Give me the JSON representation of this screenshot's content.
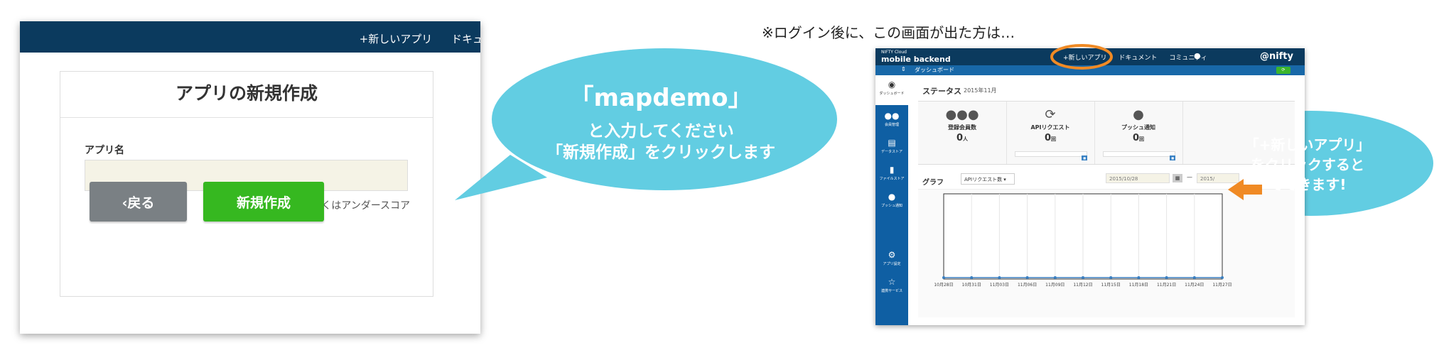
{
  "left_screen": {
    "nav_items": [
      "+新しいアプリ",
      "ドキュ"
    ],
    "card_title": "アプリの新規作成",
    "field_label": "アプリ名",
    "app_name_value": "",
    "hint": "半角英数字もしくはアンダースコア",
    "back_label": "‹戻る",
    "create_label": "新規作成"
  },
  "bubble1": {
    "line1": "「mapdemo」",
    "line2": "と入力してください",
    "line3": "「新規作成」をクリックします"
  },
  "note": "※ログイン後に、この画面が出た方は…",
  "right_screen": {
    "brand_small": "NIFTY Cloud",
    "brand": "mobile backend",
    "nav_items": [
      "+新しいアプリ",
      "ドキュメント",
      "コミュニティ"
    ],
    "logo": "@nifty",
    "breadcrumb": "ダッシュボード",
    "sidebar": [
      {
        "icon": "speedometer-icon",
        "label": "ダッシュボード"
      },
      {
        "icon": "users-icon",
        "label": "会員管理"
      },
      {
        "icon": "database-icon",
        "label": "データストア"
      },
      {
        "icon": "file-icon",
        "label": "ファイルストア"
      },
      {
        "icon": "chat-icon",
        "label": "プッシュ通知"
      },
      {
        "icon": "gear-icon",
        "label": "アプリ設定"
      },
      {
        "icon": "network-icon",
        "label": "連携サービス"
      }
    ],
    "status_title": "ステータス",
    "status_date": "2015年11月",
    "stats": [
      {
        "label": "登録会員数",
        "value": "0",
        "unit": "人"
      },
      {
        "label": "APIリクエスト",
        "value": "0",
        "unit": "回"
      },
      {
        "label": "プッシュ通知",
        "value": "0",
        "unit": "回"
      }
    ],
    "graph_title": "グラフ",
    "graph_select": "APIリクエスト数",
    "date_from": "2015/10/28",
    "date_to": "2015/",
    "chart_data": {
      "type": "line",
      "categories": [
        "10月28日",
        "10月31日",
        "11月03日",
        "11月06日",
        "11月09日",
        "11月12日",
        "11月15日",
        "11月18日",
        "11月21日",
        "11月24日",
        "11月27日"
      ],
      "values": [
        0,
        0,
        0,
        0,
        0,
        0,
        0,
        0,
        0,
        0,
        0
      ],
      "color": "#3a7fc1"
    }
  },
  "bubble2": {
    "line1": "「+新しいアプリ」",
    "line2": "をクリックすると",
    "line3": "でできます!"
  },
  "colors": {
    "bubble": "#62cde2",
    "navbar": "#0b3a5e",
    "create_button": "#36b820",
    "back_button": "#7a8084",
    "highlight_circle": "#f08a24",
    "arrow": "#f08a24"
  }
}
